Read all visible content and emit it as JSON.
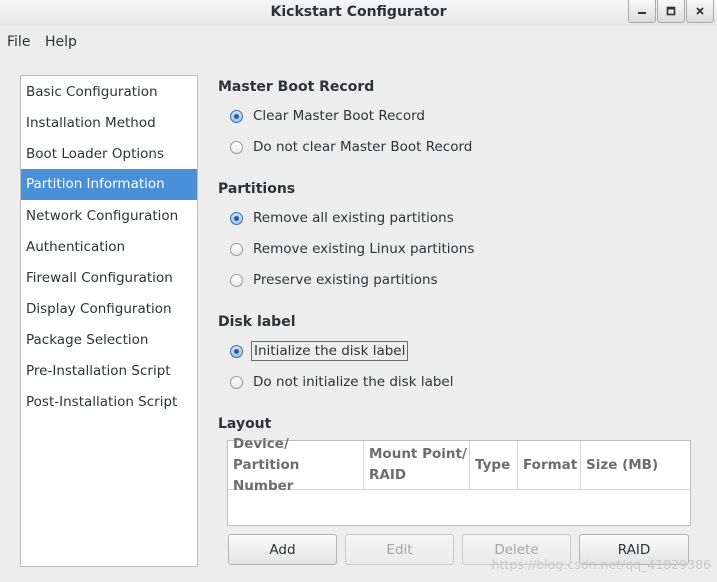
{
  "window": {
    "title": "Kickstart Configurator",
    "controls": {
      "minimize_icon": "minimize-icon",
      "maximize_icon": "maximize-icon",
      "close_icon": "close-icon"
    }
  },
  "menubar": {
    "file": "File",
    "help": "Help"
  },
  "sidebar": {
    "items": [
      {
        "label": "Basic Configuration",
        "selected": false
      },
      {
        "label": "Installation Method",
        "selected": false
      },
      {
        "label": "Boot Loader Options",
        "selected": false
      },
      {
        "label": "Partition Information",
        "selected": true
      },
      {
        "label": "Network Configuration",
        "selected": false
      },
      {
        "label": "Authentication",
        "selected": false
      },
      {
        "label": "Firewall Configuration",
        "selected": false
      },
      {
        "label": "Display Configuration",
        "selected": false
      },
      {
        "label": "Package Selection",
        "selected": false
      },
      {
        "label": "Pre-Installation Script",
        "selected": false
      },
      {
        "label": "Post-Installation Script",
        "selected": false
      }
    ]
  },
  "mbr": {
    "title": "Master Boot Record",
    "options": [
      {
        "label": "Clear Master Boot Record",
        "checked": true
      },
      {
        "label": "Do not clear Master Boot Record",
        "checked": false
      }
    ]
  },
  "partitions": {
    "title": "Partitions",
    "options": [
      {
        "label": "Remove all existing partitions",
        "checked": true
      },
      {
        "label": "Remove existing Linux partitions",
        "checked": false
      },
      {
        "label": "Preserve existing partitions",
        "checked": false
      }
    ]
  },
  "disk_label": {
    "title": "Disk label",
    "options": [
      {
        "label": "Initialize the disk label",
        "checked": true
      },
      {
        "label": "Do not initialize the disk label",
        "checked": false
      }
    ]
  },
  "layout": {
    "title": "Layout",
    "columns": {
      "device_line1": "Device/",
      "device_line2": "Partition Number",
      "mount_line1": "Mount Point/",
      "mount_line2": "RAID",
      "type": "Type",
      "format": "Format",
      "size": "Size (MB)"
    },
    "rows": []
  },
  "buttons": {
    "add": "Add",
    "edit": "Edit",
    "delete": "Delete",
    "raid": "RAID"
  },
  "watermark": "https://blog.csdn.net/qq_41829386",
  "colors": {
    "accent": "#4a90d9",
    "window_bg": "#ededed"
  }
}
